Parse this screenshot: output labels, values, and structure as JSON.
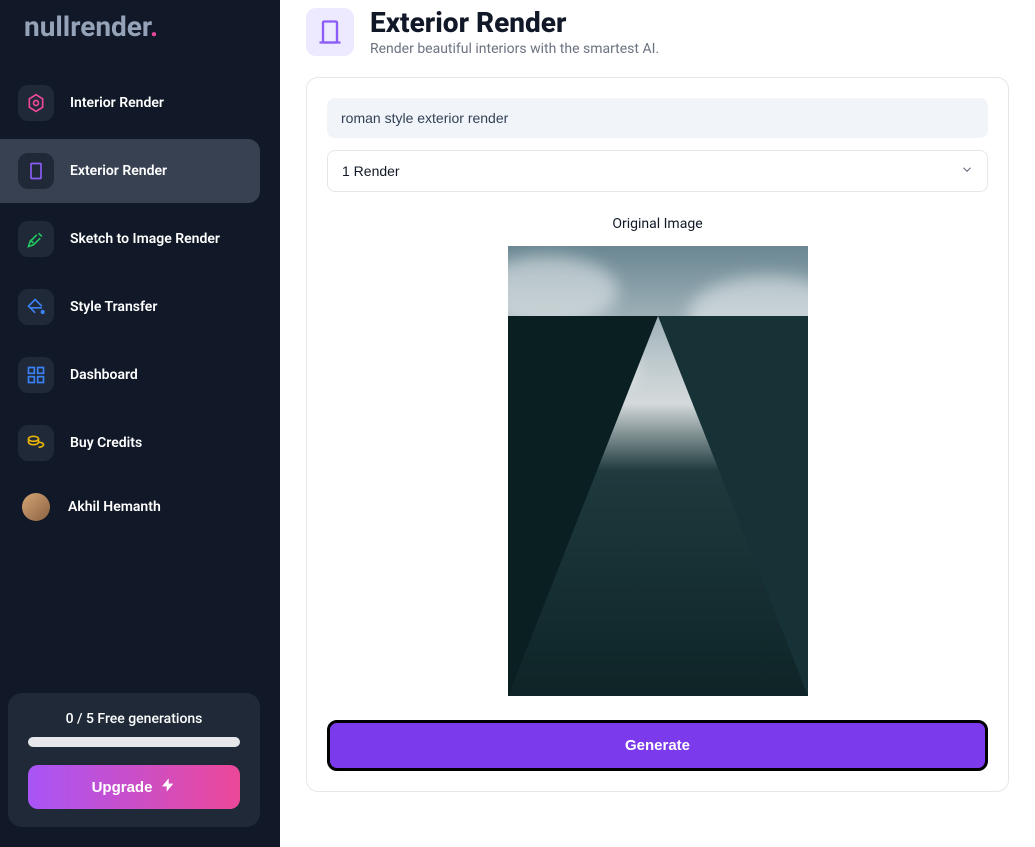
{
  "brand": {
    "name": "nullrender",
    "dot": "."
  },
  "sidebar": {
    "items": [
      {
        "label": "Interior Render",
        "icon": "hexagon-icon",
        "color": "#ec4899"
      },
      {
        "label": "Exterior Render",
        "icon": "building-icon",
        "color": "#8b5cf6",
        "active": true
      },
      {
        "label": "Sketch to Image Render",
        "icon": "pencil-ruler-icon",
        "color": "#22c55e"
      },
      {
        "label": "Style Transfer",
        "icon": "paint-bucket-icon",
        "color": "#3b82f6"
      },
      {
        "label": "Dashboard",
        "icon": "grid-icon",
        "color": "#3b82f6"
      },
      {
        "label": "Buy Credits",
        "icon": "coins-icon",
        "color": "#eab308"
      }
    ],
    "user": {
      "name": "Akhil Hemanth"
    }
  },
  "bottom": {
    "quota": "0 / 5 Free generations",
    "upgrade_label": "Upgrade",
    "progress_percent": 0
  },
  "header": {
    "title": "Exterior Render",
    "subtitle": "Render beautiful interiors with the smartest AI."
  },
  "form": {
    "prompt_value": "roman style exterior render",
    "render_count_selected": "1 Render",
    "image_label": "Original Image",
    "generate_label": "Generate"
  },
  "colors": {
    "accent": "#7c3aed",
    "sidebar_bg": "#111827"
  }
}
